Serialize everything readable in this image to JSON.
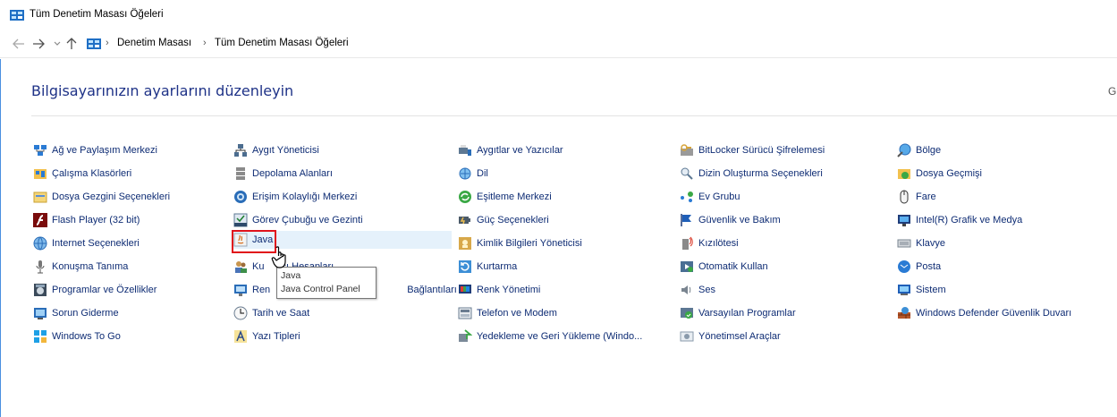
{
  "window": {
    "title": "Tüm Denetim Masası Öğeleri"
  },
  "address": {
    "back_icon": "arrow-left-icon",
    "forward_icon": "arrow-right-icon",
    "recent_icon": "chevron-down-icon",
    "up_icon": "arrow-up-icon",
    "crumbs": [
      "Denetim Masası",
      "Tüm Denetim Masası Öğeleri"
    ],
    "separator": "›"
  },
  "header": {
    "heading": "Bilgisayarınızın ayarlarını düzenleyin",
    "view_by_cut": "G"
  },
  "columns": [
    [
      "Ağ ve Paylaşım Merkezi",
      "Çalışma Klasörleri",
      "Dosya Gezgini Seçenekleri",
      "Flash Player (32 bit)",
      "Internet Seçenekleri",
      "Konuşma Tanıma",
      "Programlar ve Özellikler",
      "Sorun Giderme",
      "Windows To Go"
    ],
    [
      "Aygıt Yöneticisi",
      "Depolama Alanları",
      "Erişim Kolaylığı Merkezi",
      "Görev Çubuğu ve Gezinti",
      "Java",
      "Kullanıcı Hesapları",
      "RemoteApp ve Masaüstü Bağlantıları",
      "Tarih ve Saat",
      "Yazı Tipleri"
    ],
    [
      "Aygıtlar ve Yazıcılar",
      "Dil",
      "Eşitleme Merkezi",
      "Güç Seçenekleri",
      "Kimlik Bilgileri Yöneticisi",
      "Kurtarma",
      "Renk Yönetimi",
      "Telefon ve Modem",
      "Yedekleme ve Geri Yükleme (Windo..."
    ],
    [
      "BitLocker Sürücü Şifrelemesi",
      "Dizin Oluşturma Seçenekleri",
      "Ev Grubu",
      "Güvenlik ve Bakım",
      "Kızılötesi",
      "Otomatik Kullan",
      "Ses",
      "Varsayılan Programlar",
      "Yönetimsel Araçlar"
    ],
    [
      "Bölge",
      "Dosya Geçmişi",
      "Fare",
      "Intel(R) Grafik ve Medya",
      "Klavye",
      "Posta",
      "Sistem",
      "Windows Defender Güvenlik Duvarı"
    ]
  ],
  "col2_visible_fragments": {
    "user_accounts_left": "Ku",
    "user_accounts_right": "ıcı Hesapları",
    "remoteapp_left": "Ren",
    "remoteapp_right": "Bağlantıları"
  },
  "tooltip": {
    "line1": "Java",
    "line2": "Java Control Panel"
  },
  "colors": {
    "link": "#0e2c74",
    "heading": "#1e3287",
    "hover": "#e5f1fb",
    "highlight_box": "#e0131b"
  }
}
